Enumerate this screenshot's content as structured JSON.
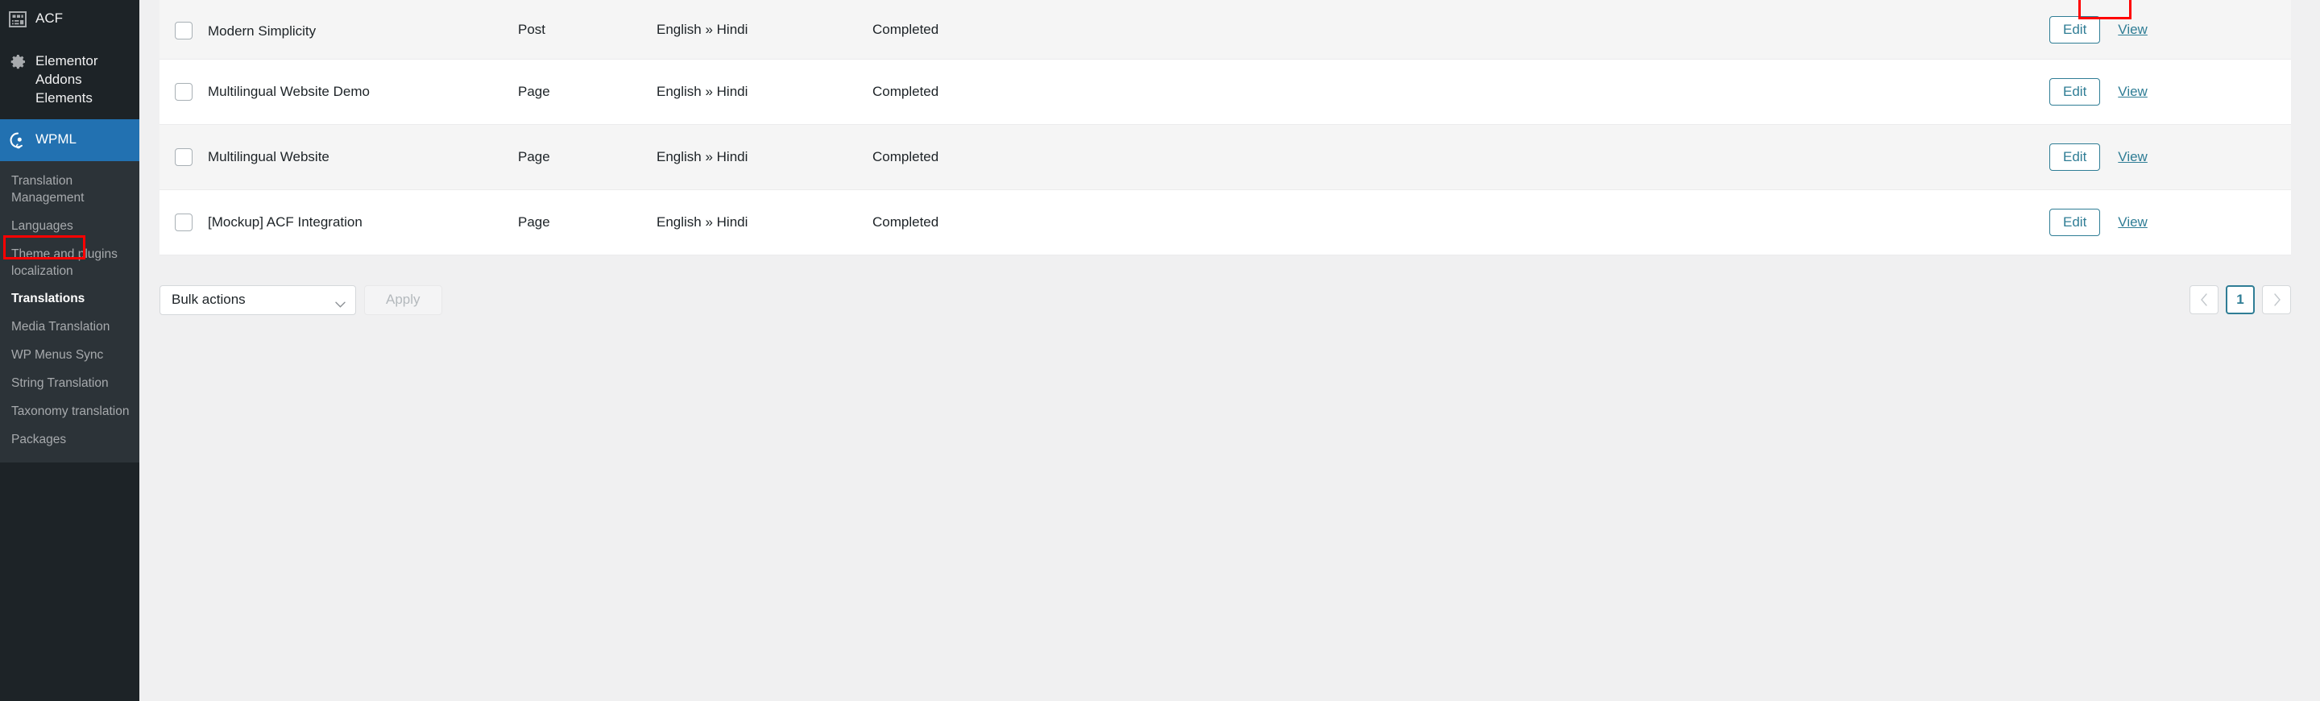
{
  "sidebar": {
    "top_items": [
      {
        "label": "ACF",
        "icon": "acf-form-icon"
      },
      {
        "label": "Elementor Addons Elements",
        "icon": "gear-icon"
      },
      {
        "label": "WPML",
        "icon": "wpml-logo-icon",
        "active": true
      }
    ],
    "submenu": [
      {
        "label": "Translation Management"
      },
      {
        "label": "Languages"
      },
      {
        "label": "Theme and plugins localization"
      },
      {
        "label": "Translations",
        "current": true,
        "annotated": true
      },
      {
        "label": "Media Translation"
      },
      {
        "label": "WP Menus Sync"
      },
      {
        "label": "String Translation"
      },
      {
        "label": "Taxonomy translation"
      },
      {
        "label": "Packages"
      }
    ],
    "active_color": "#2271b1",
    "background": "#1d2327",
    "submenu_background": "#2c3338"
  },
  "table": {
    "rows": [
      {
        "title": "Modern Simplicity",
        "type": "Post",
        "language": "English » Hindi",
        "status": "Completed",
        "edit_label": "Edit",
        "view_label": "View",
        "checked": false,
        "view_annotated": true
      },
      {
        "title": "Multilingual Website Demo",
        "type": "Page",
        "language": "English » Hindi",
        "status": "Completed",
        "edit_label": "Edit",
        "view_label": "View",
        "checked": false,
        "view_annotated": false
      },
      {
        "title": "Multilingual Website",
        "type": "Page",
        "language": "English » Hindi",
        "status": "Completed",
        "edit_label": "Edit",
        "view_label": "View",
        "checked": false,
        "view_annotated": false
      },
      {
        "title": "[Mockup] ACF Integration",
        "type": "Page",
        "language": "English » Hindi",
        "status": "Completed",
        "edit_label": "Edit",
        "view_label": "View",
        "checked": false,
        "view_annotated": false
      }
    ]
  },
  "footer": {
    "bulk_actions_value": "Bulk actions",
    "apply_label": "Apply",
    "pagination": {
      "prev_label": "‹",
      "next_label": "›",
      "current_page": "1"
    }
  },
  "annotation": {
    "color": "#ff0000"
  }
}
